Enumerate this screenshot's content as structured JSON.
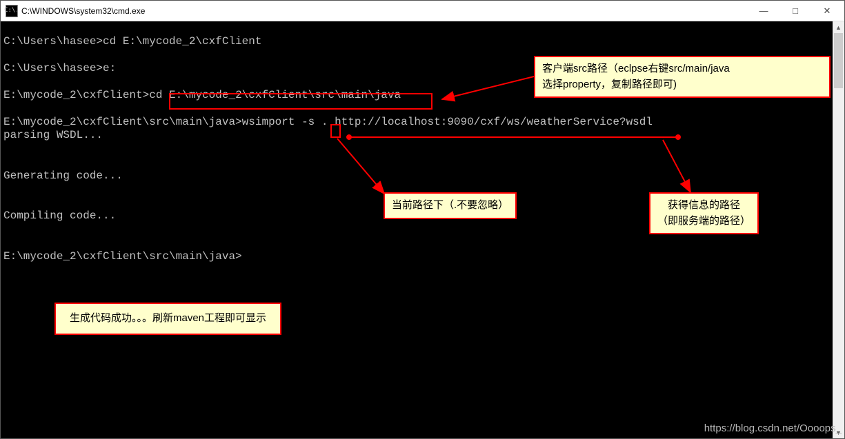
{
  "titlebar": {
    "icon_text": "C:\\.",
    "title": "C:\\WINDOWS\\system32\\cmd.exe"
  },
  "console": {
    "l1_prompt": "C:\\Users\\hasee>",
    "l1_cmd": "cd E:\\mycode_2\\cxfClient",
    "l2_prompt": "C:\\Users\\hasee>",
    "l2_cmd": "e:",
    "l3_prompt": "E:\\mycode_2\\cxfClient>",
    "l3_cmd_cd": "cd ",
    "l3_cmd_path": "E:\\mycode_2\\cxfClient\\src\\main\\java",
    "l4_prompt": "E:\\mycode_2\\cxfClient\\src\\main\\java>",
    "l4_cmd_a": "wsimport -s ",
    "l4_cmd_dot": ".",
    "l4_cmd_sp": " ",
    "l4_cmd_url": "http://localhost:9090/cxf/ws/weatherService?wsdl",
    "l5": "parsing WSDL...",
    "l6": "Generating code...",
    "l7": "Compiling code...",
    "l8_prompt": "E:\\mycode_2\\cxfClient\\src\\main\\java>"
  },
  "annotations": {
    "top_right_1": "客户端src路径（eclpse右键src/main/java",
    "top_right_2": "选择property，复制路径即可)",
    "mid": "当前路径下（.不要忽略）",
    "right": "获得信息的路径",
    "right_2": "（即服务端的路径）",
    "bottom": "生成代码成功。。。刷新maven工程即可显示"
  },
  "watermark": "https://blog.csdn.net/Oooops_"
}
